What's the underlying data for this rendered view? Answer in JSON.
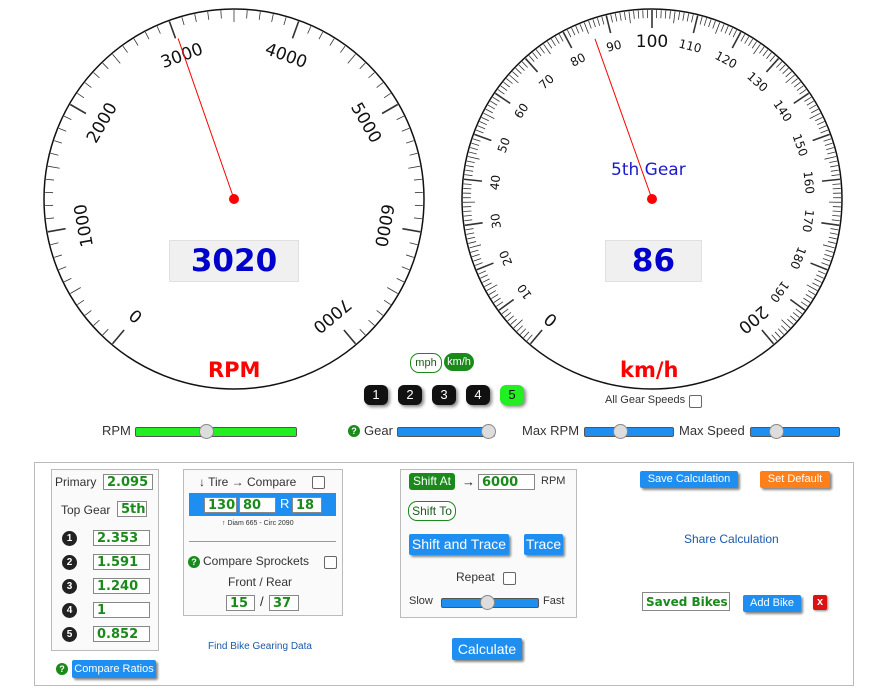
{
  "rpm_gauge": {
    "ticks": [
      "0",
      "1000",
      "2000",
      "3000",
      "4000",
      "5000",
      "6000",
      "7000"
    ],
    "unit_label": "RPM",
    "readout": "3020",
    "needle_value": 3020
  },
  "speed_gauge": {
    "ticks": [
      "0",
      "10",
      "20",
      "30",
      "40",
      "50",
      "60",
      "70",
      "80",
      "90",
      "100",
      "110",
      "120",
      "130",
      "140",
      "150",
      "160",
      "170",
      "180",
      "190",
      "200"
    ],
    "unit_label": "km/h",
    "gear_label": "5th Gear",
    "readout": "86",
    "needle_value": 86
  },
  "units": {
    "mph": "mph",
    "kmh": "km/h",
    "selected": "km/h"
  },
  "gear_buttons": [
    "1",
    "2",
    "3",
    "4",
    "5"
  ],
  "selected_gear": "5",
  "all_gear_speeds": "All Gear Speeds",
  "sliders": {
    "rpm": "RPM",
    "gear": "Gear",
    "max_rpm": "Max RPM",
    "max_speed": "Max Speed"
  },
  "ratios": {
    "primary_label": "Primary",
    "primary_value": "2.095",
    "top_gear_label": "Top Gear",
    "top_gear_value": "5th",
    "gears": [
      {
        "num": "1",
        "value": "2.353"
      },
      {
        "num": "2",
        "value": "1.591"
      },
      {
        "num": "3",
        "value": "1.240"
      },
      {
        "num": "4",
        "value": "1"
      },
      {
        "num": "5",
        "value": "0.852"
      }
    ],
    "compare_button": "Compare Ratios"
  },
  "tire": {
    "heading": "↓ Tire → Compare",
    "width": "130",
    "aspect": "80",
    "r_label": "R",
    "rim": "18",
    "note": "↑ Diam 665 - Circ 2090",
    "sprockets_label": "Compare Sprockets",
    "front_rear_label": "Front / Rear",
    "front": "15",
    "slash": "/",
    "rear": "37",
    "find_link": "Find Bike Gearing Data"
  },
  "shift": {
    "shift_at_button": "Shift At",
    "arrow": "→",
    "shift_rpm": "6000",
    "rpm_label": "RPM",
    "shift_to_button": "Shift To",
    "shift_trace_button": "Shift and Trace",
    "trace_button": "Trace",
    "repeat_label": "Repeat",
    "slow_label": "Slow",
    "fast_label": "Fast",
    "calculate_button": "Calculate"
  },
  "actions": {
    "save_calc": "Save Calculation",
    "set_default": "Set Default",
    "share_calc": "Share Calculation",
    "saved_bikes": "Saved Bikes",
    "add_bike": "Add Bike",
    "delete": "x"
  },
  "colors": {
    "needle": "#ff0000",
    "readout": "#0000cc",
    "unit": "#ff0000",
    "green": "#1a8a1a",
    "blue": "#1e8ff0",
    "orange": "#ff7f1a"
  }
}
